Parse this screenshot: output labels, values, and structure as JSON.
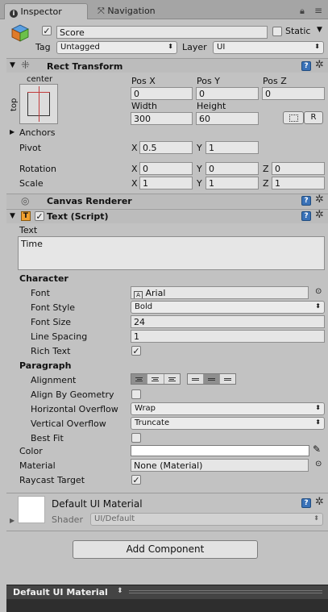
{
  "tabs": [
    {
      "label": "Inspector",
      "icon": "info-icon",
      "active": true
    },
    {
      "label": "Navigation",
      "icon": "navigation-icon",
      "active": false
    }
  ],
  "gameobject": {
    "name": "Score",
    "static_label": "Static",
    "active": true,
    "static": false,
    "tag_label": "Tag",
    "tag_value": "Untagged",
    "layer_label": "Layer",
    "layer_value": "UI"
  },
  "rect_transform": {
    "title": "Rect Transform",
    "anchor_h": "center",
    "anchor_v": "top",
    "pos_x_label": "Pos X",
    "pos_y_label": "Pos Y",
    "pos_z_label": "Pos Z",
    "pos_x": "0",
    "pos_y": "0",
    "pos_z": "0",
    "width_label": "Width",
    "height_label": "Height",
    "width": "300",
    "height": "60",
    "r_button": "R",
    "anchors_label": "Anchors",
    "pivot_label": "Pivot",
    "pivot_x": "0.5",
    "pivot_y": "1",
    "rotation_label": "Rotation",
    "rot_x": "0",
    "rot_y": "0",
    "rot_z": "0",
    "scale_label": "Scale",
    "scale_x": "1",
    "scale_y": "1",
    "scale_z": "1",
    "x": "X",
    "y": "Y",
    "z": "Z"
  },
  "canvas_renderer": {
    "title": "Canvas Renderer"
  },
  "text_component": {
    "title": "Text (Script)",
    "enabled": true,
    "text_label": "Text",
    "text_value": "Time",
    "character_label": "Character",
    "font_label": "Font",
    "font_value": "Arial",
    "font_style_label": "Font Style",
    "font_style_value": "Bold",
    "font_size_label": "Font Size",
    "font_size_value": "24",
    "line_spacing_label": "Line Spacing",
    "line_spacing_value": "1",
    "rich_text_label": "Rich Text",
    "rich_text": true,
    "paragraph_label": "Paragraph",
    "alignment_label": "Alignment",
    "align_by_geometry_label": "Align By Geometry",
    "align_by_geometry": false,
    "horizontal_overflow_label": "Horizontal Overflow",
    "horizontal_overflow_value": "Wrap",
    "vertical_overflow_label": "Vertical Overflow",
    "vertical_overflow_value": "Truncate",
    "best_fit_label": "Best Fit",
    "best_fit": false,
    "color_label": "Color",
    "color_value": "#ffffff",
    "material_label": "Material",
    "material_value": "None (Material)",
    "raycast_label": "Raycast Target",
    "raycast": true
  },
  "material": {
    "name": "Default UI Material",
    "shader_label": "Shader",
    "shader_value": "UI/Default"
  },
  "add_component": "Add Component",
  "preview": {
    "title": "Default UI Material"
  },
  "colors": {
    "help": "#3a72b8",
    "panel": "#c2c2c2",
    "preview_bg": "#2e2e2e"
  }
}
